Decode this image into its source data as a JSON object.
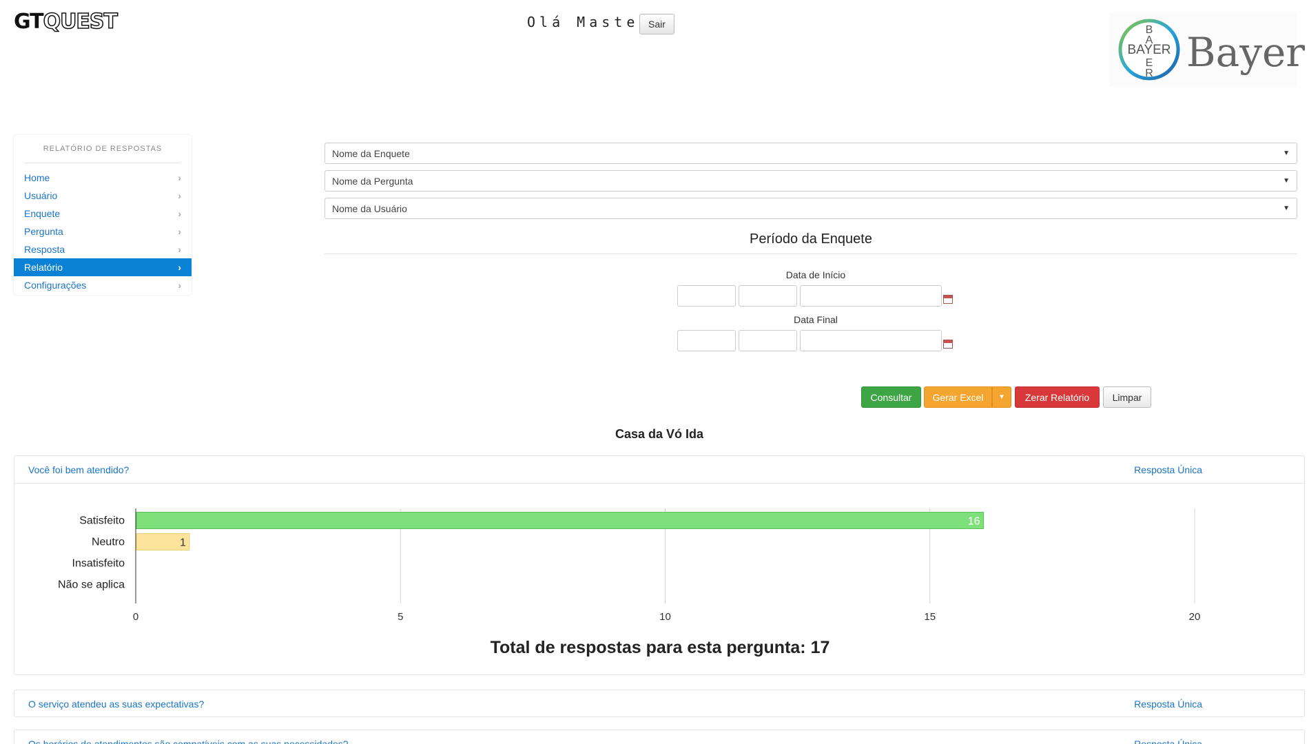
{
  "header": {
    "logo_gt": "GT",
    "logo_quest": "QUEST",
    "greeting": "Olá Master",
    "logout_label": "Sair",
    "brand_name": "Bayer",
    "brand_seal_letters": "BAYER"
  },
  "sidebar": {
    "title": "RELATÓRIO DE RESPOSTAS",
    "items": [
      {
        "label": "Home",
        "active": false
      },
      {
        "label": "Usuário",
        "active": false
      },
      {
        "label": "Enquete",
        "active": false
      },
      {
        "label": "Pergunta",
        "active": false
      },
      {
        "label": "Resposta",
        "active": false
      },
      {
        "label": "Relatório",
        "active": true
      },
      {
        "label": "Configurações",
        "active": false
      }
    ]
  },
  "filters": {
    "survey_select": "Nome da Enquete",
    "question_select": "Nome da Pergunta",
    "user_select": "Nome da Usuário",
    "period_title": "Período da Enquete",
    "start_label": "Data de Início",
    "end_label": "Data Final"
  },
  "actions": {
    "consult": "Consultar",
    "excel": "Gerar Excel",
    "reset": "Zerar Relatório",
    "clear": "Limpar"
  },
  "survey_title": "Casa da Vó Ida",
  "questions": [
    {
      "text": "Você foi bem atendido?",
      "type": "Resposta Única",
      "total_text": "Total de respostas para esta pergunta: 17"
    },
    {
      "text": "O serviço atendeu as suas expectativas?",
      "type": "Resposta Única"
    },
    {
      "text": "Os horários de atendimentos são compatíveis com as suas necessidades?",
      "type": "Resposta Única"
    }
  ],
  "chart_data": {
    "type": "bar",
    "orientation": "horizontal",
    "categories": [
      "Satisfeito",
      "Neutro",
      "Insatisfeito",
      "Não se aplica"
    ],
    "values": [
      16,
      1,
      0,
      0
    ],
    "colors": [
      "#7ee07a",
      "#fce49a",
      "#cccccc",
      "#cccccc"
    ],
    "xlim": [
      0,
      20
    ],
    "xticks": [
      0,
      5,
      10,
      15,
      20
    ],
    "grid": true
  },
  "colors": {
    "link": "#1a75c9",
    "active_nav": "#0b82d3",
    "consult": "#3ea544",
    "excel": "#f3a52f",
    "reset": "#d9383a"
  }
}
